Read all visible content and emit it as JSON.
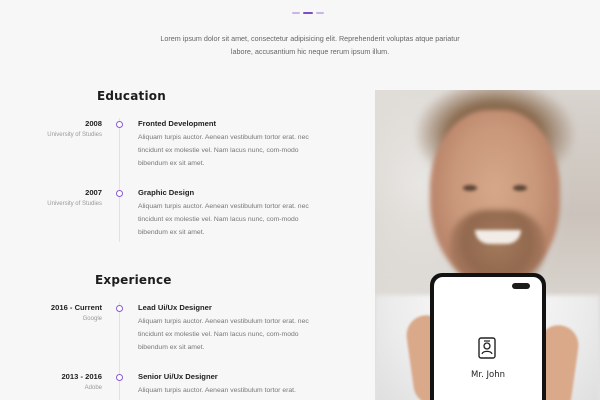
{
  "intro": {
    "text": "Lorem ipsum dolor sit amet, consectetur adipisicing elit. Reprehenderit voluptas atque pariatur labore, accusantium hic neque rerum ipsum illum."
  },
  "education": {
    "title": "Education",
    "entries": [
      {
        "date": "2008",
        "org": "University of Studies",
        "role": "Fronted Development",
        "desc": "Aliquam turpis auctor. Aenean vestibulum tortor erat. nec tincidunt ex molestie vel. Nam lacus nunc, com-modo bibendum ex sit amet."
      },
      {
        "date": "2007",
        "org": "University of Studies",
        "role": "Graphic Design",
        "desc": "Aliquam turpis auctor. Aenean vestibulum tortor erat. nec tincidunt ex molestie vel. Nam lacus nunc, com-modo bibendum ex sit amet."
      }
    ]
  },
  "experience": {
    "title": "Experience",
    "entries": [
      {
        "date": "2016 - Current",
        "org": "Google",
        "role": "Lead Ui/Ux Designer",
        "desc": "Aliquam turpis auctor. Aenean vestibulum tortor erat. nec tincidunt ex molestie vel. Nam lacus nunc, com-modo bibendum ex sit amet."
      },
      {
        "date": "2013 - 2016",
        "org": "Adobe",
        "role": "Senior Ui/Ux Designer",
        "desc": "Aliquam turpis auctor. Aenean vestibulum tortor erat."
      }
    ]
  },
  "phone": {
    "name": "Mr. John",
    "icon": "id-card-icon"
  },
  "colors": {
    "accent": "#7b4fc4"
  }
}
